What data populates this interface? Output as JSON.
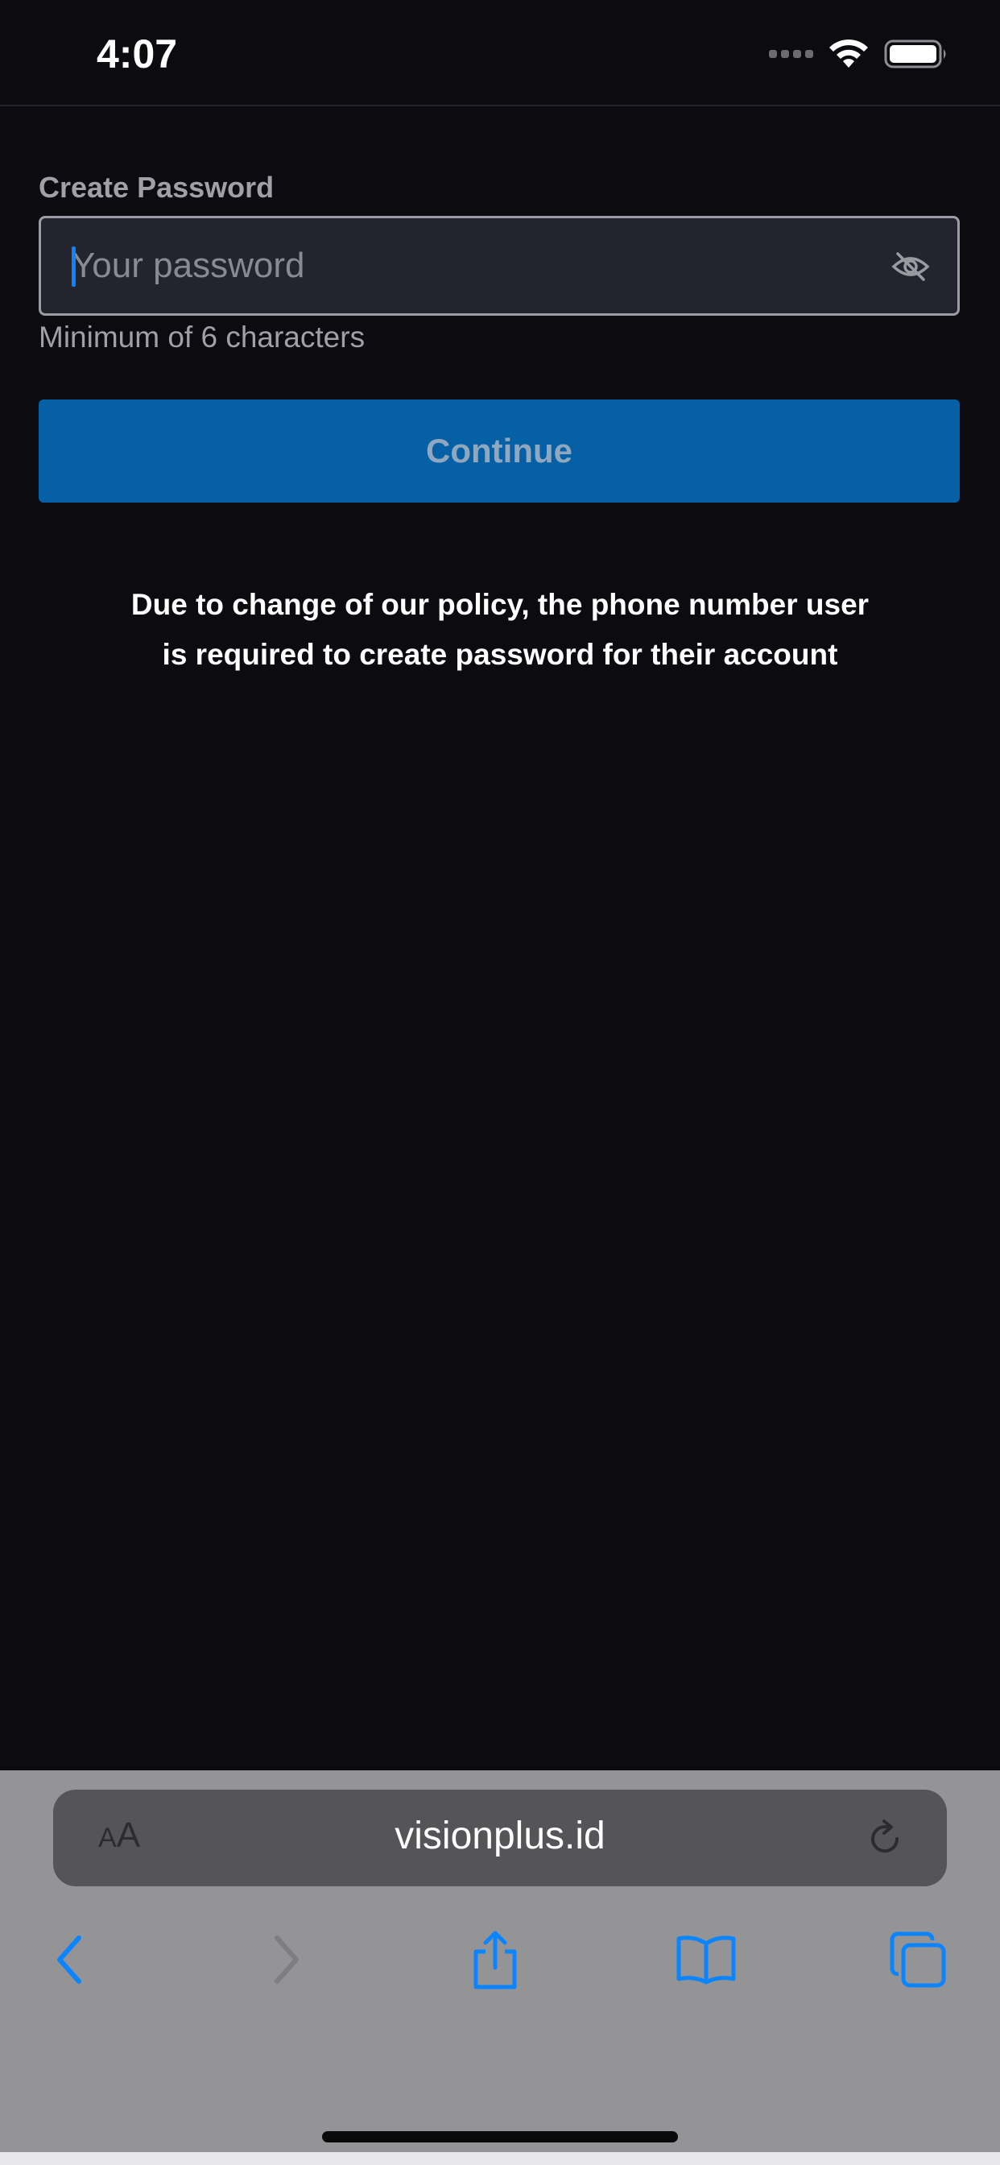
{
  "status_bar": {
    "time": "4:07"
  },
  "form": {
    "label": "Create Password",
    "password_placeholder": "Your password",
    "helper": "Minimum of 6 characters",
    "continue_label": "Continue",
    "policy_line1": "Due to change of our policy, the phone number user",
    "policy_line2": "is required to create password for their account"
  },
  "browser": {
    "text_size_label_small": "A",
    "text_size_label_large": "A",
    "url": "visionplus.id"
  },
  "colors": {
    "background": "#0b0b10",
    "accent_button": "#0560a6",
    "safari_tint": "#0a84ff"
  },
  "icons": {
    "wifi": "wifi-icon",
    "battery": "battery-icon",
    "eye_off": "eye-off-icon",
    "reload": "reload-icon",
    "back": "chevron-left-icon",
    "forward": "chevron-right-icon",
    "share": "share-icon",
    "bookmarks": "book-icon",
    "tabs": "tabs-icon"
  }
}
